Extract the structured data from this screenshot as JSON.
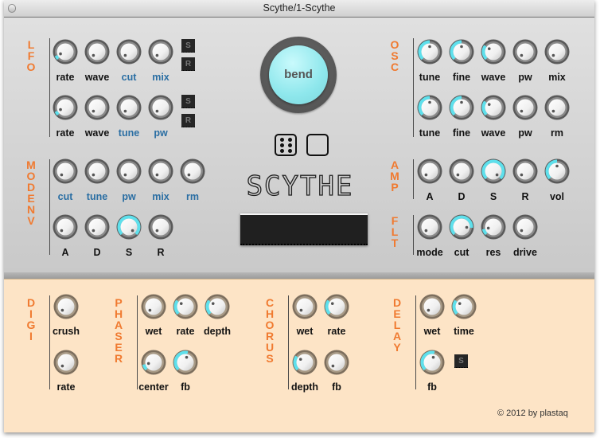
{
  "window": {
    "title": "Scythe/1-Scythe"
  },
  "colors": {
    "accent_orange": "#f07a30",
    "knob_arc_cyan": "#5ee0ec",
    "label_blue": "#2a6ea3",
    "upper_panel": "#d6d6d6",
    "lower_panel": "#fde4c6",
    "lcd": "#202020"
  },
  "sections": {
    "lfo": {
      "title": "LFO",
      "row1": [
        {
          "label": "rate",
          "value": 0.08,
          "blue": false
        },
        {
          "label": "wave",
          "value": 0.0,
          "blue": false
        },
        {
          "label": "cut",
          "value": 0.0,
          "blue": true
        },
        {
          "label": "mix",
          "value": 0.0,
          "blue": true
        }
      ],
      "row2": [
        {
          "label": "rate",
          "value": 0.08,
          "blue": false
        },
        {
          "label": "wave",
          "value": 0.0,
          "blue": false
        },
        {
          "label": "tune",
          "value": 0.0,
          "blue": true
        },
        {
          "label": "pw",
          "value": 0.0,
          "blue": true
        }
      ],
      "buttons": [
        "S",
        "R",
        "S",
        "R"
      ]
    },
    "modenv": {
      "title": "MODENV",
      "row1": [
        {
          "label": "cut",
          "value": 0.0,
          "blue": true
        },
        {
          "label": "tune",
          "value": 0.0,
          "blue": true
        },
        {
          "label": "pw",
          "value": 0.0,
          "blue": true
        },
        {
          "label": "mix",
          "value": 0.0,
          "blue": true
        },
        {
          "label": "rm",
          "value": 0.0,
          "blue": true
        }
      ],
      "row2": [
        {
          "label": "A",
          "value": 0.0,
          "blue": false
        },
        {
          "label": "D",
          "value": 0.0,
          "blue": false
        },
        {
          "label": "S",
          "value": 1.0,
          "blue": false
        },
        {
          "label": "R",
          "value": 0.0,
          "blue": false
        }
      ]
    },
    "osc": {
      "title": "OSC",
      "row1": [
        {
          "label": "tune",
          "value": 0.5,
          "blue": false
        },
        {
          "label": "fine",
          "value": 0.5,
          "blue": false
        },
        {
          "label": "wave",
          "value": 0.3,
          "blue": false
        },
        {
          "label": "pw",
          "value": 0.0,
          "blue": false
        },
        {
          "label": "mix",
          "value": 0.0,
          "blue": false
        }
      ],
      "row2": [
        {
          "label": "tune",
          "value": 0.5,
          "blue": false
        },
        {
          "label": "fine",
          "value": 0.5,
          "blue": false
        },
        {
          "label": "wave",
          "value": 0.3,
          "blue": false
        },
        {
          "label": "pw",
          "value": 0.0,
          "blue": false
        },
        {
          "label": "rm",
          "value": 0.0,
          "blue": false
        }
      ]
    },
    "amp": {
      "title": "AMP",
      "row1": [
        {
          "label": "A",
          "value": 0.0,
          "blue": false
        },
        {
          "label": "D",
          "value": 0.0,
          "blue": false
        },
        {
          "label": "S",
          "value": 1.0,
          "blue": false
        },
        {
          "label": "R",
          "value": 0.0,
          "blue": false
        },
        {
          "label": "vol",
          "value": 0.5,
          "blue": false
        }
      ]
    },
    "flt": {
      "title": "FLT",
      "row1": [
        {
          "label": "mode",
          "value": 0.0,
          "blue": false
        },
        {
          "label": "cut",
          "value": 0.85,
          "blue": false
        },
        {
          "label": "res",
          "value": 0.12,
          "blue": false
        },
        {
          "label": "drive",
          "value": 0.0,
          "blue": false
        }
      ]
    },
    "digi": {
      "title": "DIGI",
      "knobs": [
        {
          "label": "crush",
          "value": 0.0
        },
        {
          "label": "rate",
          "value": 0.0
        }
      ]
    },
    "phaser": {
      "title": "PHASER",
      "knobs": [
        {
          "label": "wet",
          "value": 0.0
        },
        {
          "label": "rate",
          "value": 0.3
        },
        {
          "label": "depth",
          "value": 0.3
        },
        {
          "label": "center",
          "value": 0.12
        },
        {
          "label": "fb",
          "value": 0.55
        }
      ]
    },
    "chorus": {
      "title": "CHORUS",
      "knobs": [
        {
          "label": "wet",
          "value": 0.0
        },
        {
          "label": "rate",
          "value": 0.3
        },
        {
          "label": "depth",
          "value": 0.3
        },
        {
          "label": "fb",
          "value": 0.0
        }
      ]
    },
    "delay": {
      "title": "DELAY",
      "knobs": [
        {
          "label": "wet",
          "value": 0.0
        },
        {
          "label": "time",
          "value": 0.3
        },
        {
          "label": "fb",
          "value": 0.55
        }
      ],
      "button": "S"
    }
  },
  "center": {
    "bend_label": "bend",
    "logo": "SCYTHE",
    "dice_icon": "dice-six",
    "blank_icon": "empty-square"
  },
  "footer": {
    "copyright": "© 2012 by plastaq"
  }
}
